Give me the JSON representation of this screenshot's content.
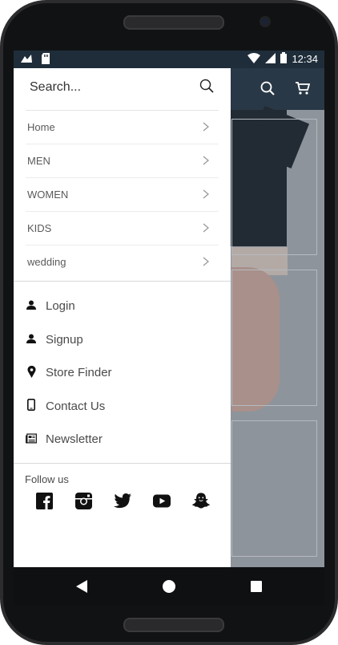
{
  "status_bar": {
    "time": "12:34",
    "icons": [
      "notification-icon",
      "sd-card-icon",
      "wifi-icon",
      "signal-icon",
      "battery-icon"
    ]
  },
  "app_bar": {
    "icons": [
      "search-icon",
      "cart-icon"
    ]
  },
  "drawer": {
    "search": {
      "placeholder": "Search..."
    },
    "categories": [
      {
        "label": "Home"
      },
      {
        "label": "MEN"
      },
      {
        "label": "WOMEN"
      },
      {
        "label": "KIDS"
      },
      {
        "label": "wedding"
      }
    ],
    "account_links": [
      {
        "label": "Login",
        "icon": "user-icon"
      },
      {
        "label": "Signup",
        "icon": "user-icon"
      },
      {
        "label": "Store Finder",
        "icon": "location-pin-icon"
      },
      {
        "label": "Contact Us",
        "icon": "phone-icon"
      },
      {
        "label": "Newsletter",
        "icon": "newspaper-icon"
      }
    ],
    "follow": {
      "label": "Follow us",
      "networks": [
        "facebook-icon",
        "instagram-icon",
        "twitter-icon",
        "youtube-icon",
        "snapchat-icon"
      ]
    }
  },
  "colors": {
    "status_bar": "#1f2d3a",
    "app_bar": "#293846",
    "drawer_bg": "#ffffff"
  }
}
